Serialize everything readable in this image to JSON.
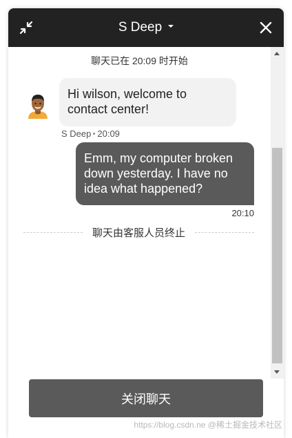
{
  "header": {
    "title": "S Deep",
    "minimize_icon": "minimize-arrows-icon",
    "close_icon": "close-icon",
    "background": "#222222"
  },
  "chat": {
    "started_notice": "聊天已在 20:09 时开始",
    "messages": [
      {
        "sender": "agent",
        "text": "Hi wilson, welcome to contact center!",
        "meta_name": "S Deep",
        "meta_time": "20:09"
      },
      {
        "sender": "user",
        "text": "Emm, my computer broken down yesterday. I have no idea what happened?",
        "time": "20:10"
      }
    ],
    "ended_notice": "聊天由客服人员终止"
  },
  "footer": {
    "close_chat_label": "关闭聊天",
    "button_color": "#5a5a5a"
  },
  "watermark": "https://blog.csdn.ne @稀土掘金技术社区"
}
